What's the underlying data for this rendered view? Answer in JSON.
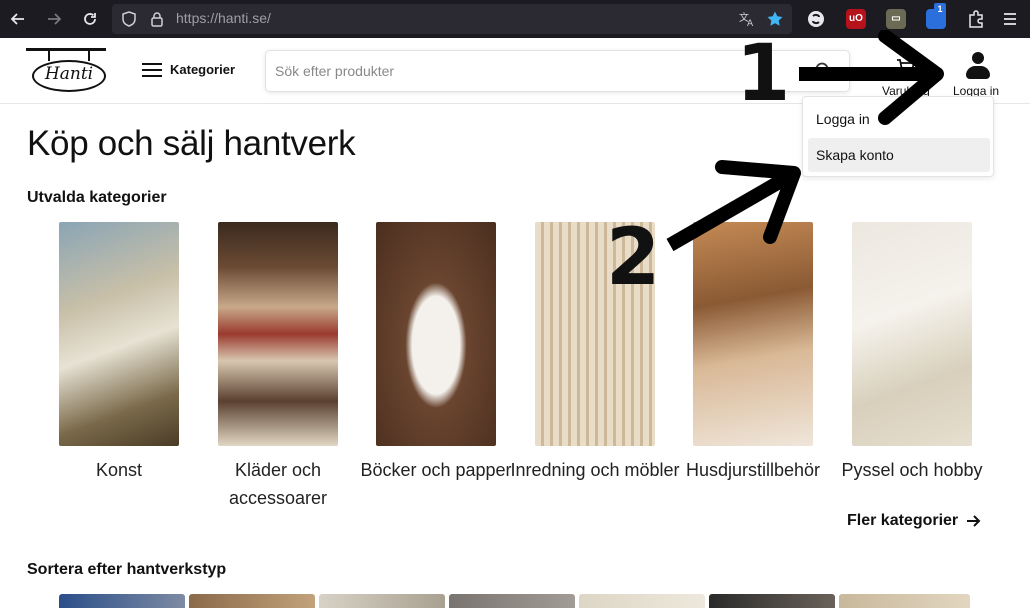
{
  "browser": {
    "url": "https://hanti.se/",
    "back_icon": "back-arrow-icon",
    "forward_icon": "forward-arrow-icon",
    "reload_icon": "reload-icon",
    "extension_badge": "1"
  },
  "header": {
    "logo_text": "Hanti",
    "menu_label": "Kategorier",
    "search_placeholder": "Sök efter produkter",
    "cart_label": "Varukorg",
    "login_label": "Logga in"
  },
  "dropdown": {
    "items": [
      {
        "label": "Logga in"
      },
      {
        "label": "Skapa konto"
      }
    ]
  },
  "main": {
    "title": "Köp och sälj hantverk",
    "featured_title": "Utvalda kategorier",
    "categories": [
      {
        "label": "Konst"
      },
      {
        "label": "Kläder och accessoarer"
      },
      {
        "label": "Böcker och papper"
      },
      {
        "label": "Inredning och möbler"
      },
      {
        "label": "Husdjurstillbehör"
      },
      {
        "label": "Pyssel och hobby"
      }
    ],
    "more_categories": "Fler kategorier",
    "craft_title": "Sortera efter hantverkstyp"
  },
  "annotations": {
    "one": "1",
    "two": "2"
  },
  "colors": {
    "browser_bg": "#1c1b22",
    "url_bg": "#2b2a33",
    "bookmark_star": "#41b6f5",
    "ublock_red": "#b5121b"
  }
}
